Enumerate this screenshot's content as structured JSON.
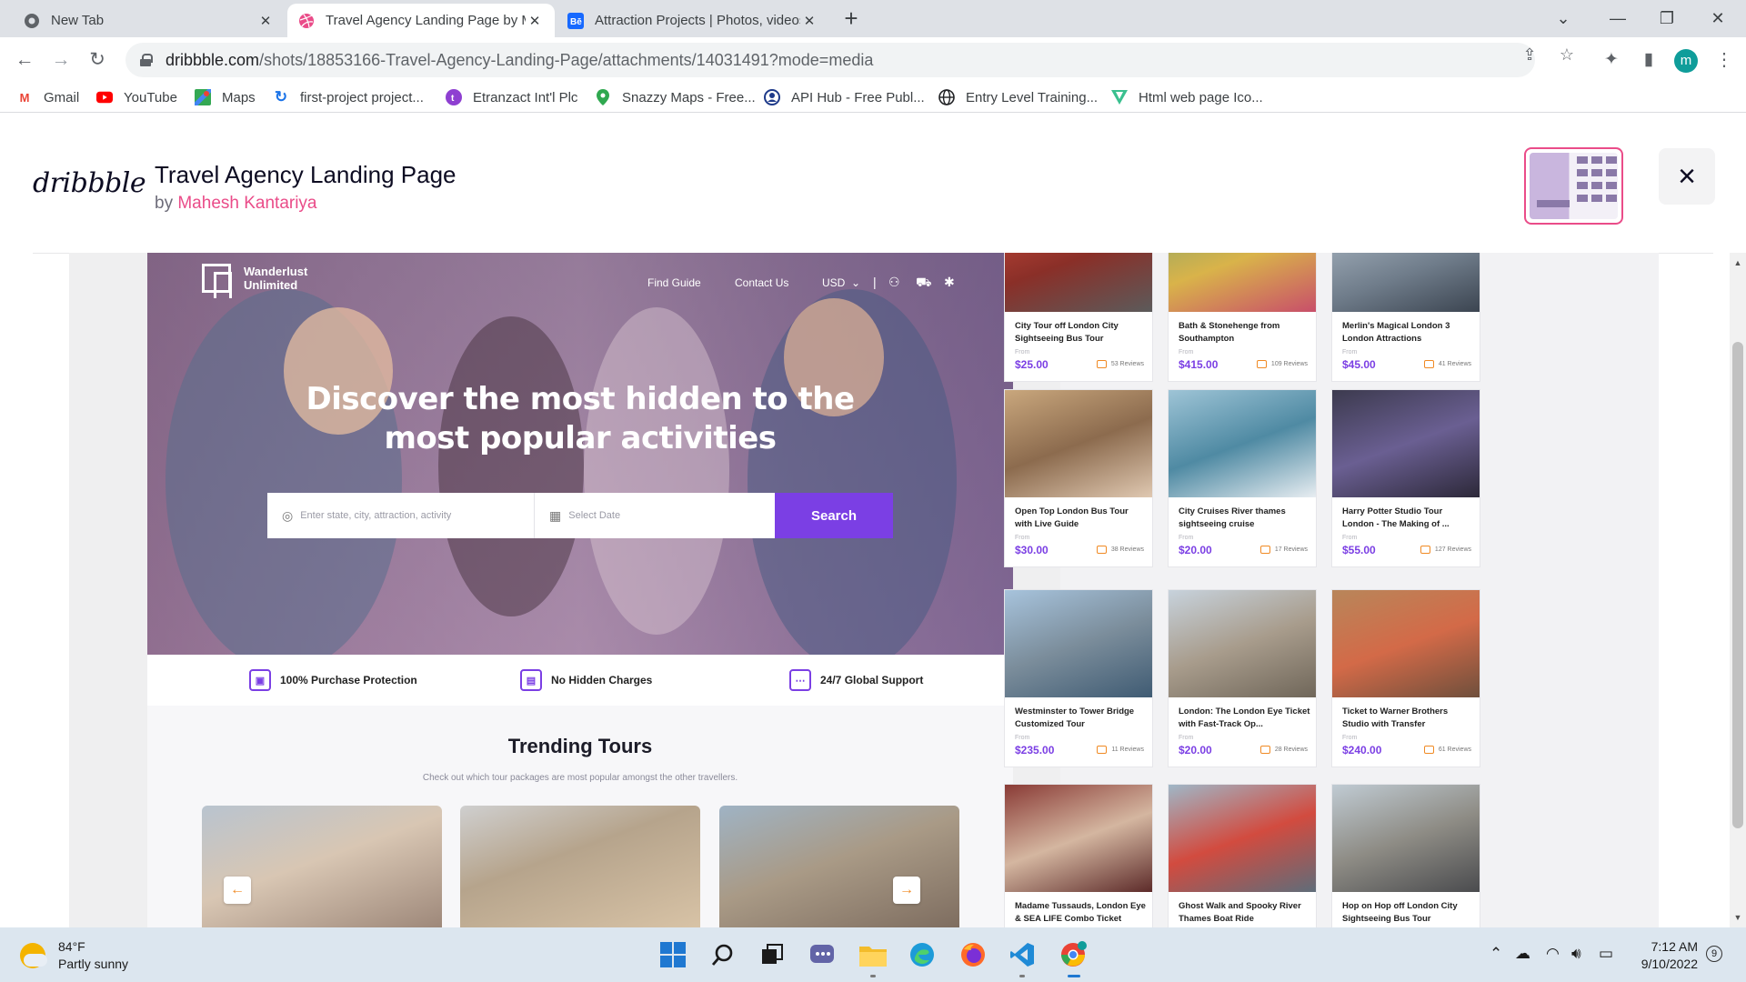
{
  "browser": {
    "tabs": [
      {
        "title": "New Tab",
        "active": false
      },
      {
        "title": "Travel Agency Landing Page by M",
        "active": true
      },
      {
        "title": "Attraction Projects | Photos, videos",
        "active": false
      }
    ],
    "new_tab_symbol": "+",
    "url_host": "dribbble.com",
    "url_path": "/shots/18853166-Travel-Agency-Landing-Page/attachments/14031491?mode=media",
    "profile_initial": "m",
    "bookmarks": [
      {
        "label": "Gmail",
        "icon": "gmail-icon"
      },
      {
        "label": "YouTube",
        "icon": "youtube-icon"
      },
      {
        "label": "Maps",
        "icon": "maps-icon"
      },
      {
        "label": "first-project project...",
        "icon": "firebase-icon"
      },
      {
        "label": "Etranzact Int'l Plc",
        "icon": "etranzact-icon"
      },
      {
        "label": "Snazzy Maps - Free...",
        "icon": "map-pin-icon"
      },
      {
        "label": "API Hub - Free Publ...",
        "icon": "api-hub-icon"
      },
      {
        "label": "Entry Level Training...",
        "icon": "globe-icon"
      },
      {
        "label": "Html web page Ico...",
        "icon": "bookmark-v-icon"
      }
    ]
  },
  "shot": {
    "logo": "dribbble",
    "title": "Travel Agency Landing Page",
    "by_prefix": "by",
    "author": "Mahesh Kantariya"
  },
  "mock_page": {
    "brand_line1": "Wanderlust",
    "brand_line2": "Unlimited",
    "nav": {
      "find_guide": "Find Guide",
      "contact_us": "Contact Us",
      "currency": "USD"
    },
    "hero_title_line1": "Discover the most hidden to the",
    "hero_title_line2": "most popular activities",
    "search": {
      "location_placeholder": "Enter state, city, attraction, activity",
      "date_placeholder": "Select Date",
      "button": "Search"
    },
    "features": [
      "100% Purchase Protection",
      "No Hidden Charges",
      "24/7 Global Support"
    ],
    "trending_title": "Trending Tours",
    "trending_subtitle": "Check out which tour packages are most popular amongst the other travellers."
  },
  "tour_cards": [
    {
      "name": "City Tour off London City Sightseeing Bus Tour",
      "from": "From",
      "price": "$25.00",
      "reviews": "53 Reviews"
    },
    {
      "name": "Bath & Stonehenge from Southampton",
      "from": "From",
      "price": "$415.00",
      "reviews": "109 Reviews"
    },
    {
      "name": "Merlin's Magical London 3 London Attractions",
      "from": "From",
      "price": "$45.00",
      "reviews": "41 Reviews"
    },
    {
      "name": "Open Top London Bus Tour with Live Guide",
      "from": "From",
      "price": "$30.00",
      "reviews": "38 Reviews"
    },
    {
      "name": "City Cruises River thames sightseeing cruise",
      "from": "From",
      "price": "$20.00",
      "reviews": "17 Reviews"
    },
    {
      "name": "Harry Potter Studio Tour London - The Making of ...",
      "from": "From",
      "price": "$55.00",
      "reviews": "127 Reviews"
    },
    {
      "name": "Westminster to Tower Bridge Customized Tour",
      "from": "From",
      "price": "$235.00",
      "reviews": "11 Reviews"
    },
    {
      "name": "London: The London Eye Ticket with Fast-Track Op...",
      "from": "From",
      "price": "$20.00",
      "reviews": "28 Reviews"
    },
    {
      "name": "Ticket to Warner Brothers Studio with Transfer",
      "from": "From",
      "price": "$240.00",
      "reviews": "61 Reviews"
    },
    {
      "name": "Madame Tussauds, London Eye & SEA LIFE Combo Ticket",
      "from": "",
      "price": "",
      "reviews": ""
    },
    {
      "name": "Ghost Walk and Spooky River Thames Boat Ride",
      "from": "",
      "price": "",
      "reviews": ""
    },
    {
      "name": "Hop on Hop off London City Sightseeing Bus Tour",
      "from": "",
      "price": "",
      "reviews": ""
    }
  ],
  "taskbar": {
    "temperature": "84°F",
    "condition": "Partly sunny",
    "time": "7:12 AM",
    "date": "9/10/2022",
    "notifications": "9"
  },
  "colors": {
    "accent_purple": "#7b3fe4",
    "dribbble_pink": "#ea4c89"
  }
}
